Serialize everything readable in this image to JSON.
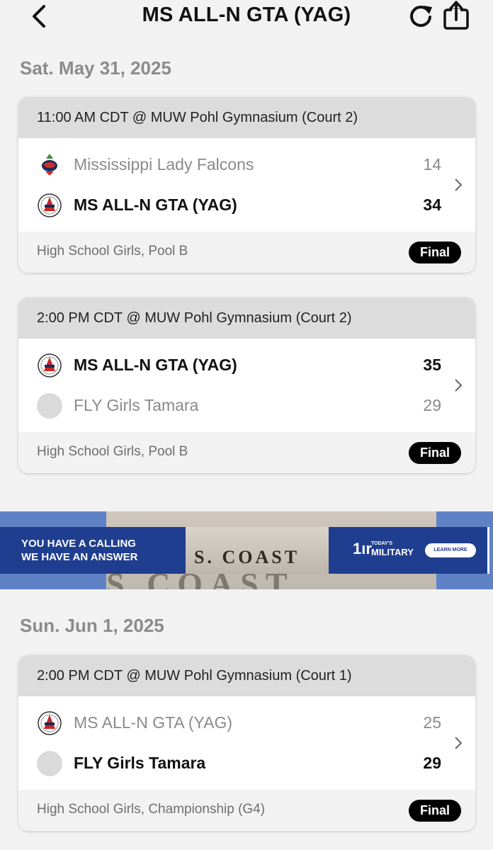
{
  "header": {
    "title": "MS ALL-N GTA (YAG)",
    "back_icon": "chevron-left-icon",
    "refresh_icon": "refresh-icon",
    "share_icon": "share-icon"
  },
  "days": [
    {
      "date": "Sat. May 31, 2025",
      "games": [
        {
          "header": "11:00 AM CDT @ MUW Pohl Gymnasium  (Court 2)",
          "teams": [
            {
              "name": "Mississippi Lady Falcons",
              "score": "14",
              "winner": false
            },
            {
              "name": "MS ALL-N GTA (YAG)",
              "score": "34",
              "winner": true
            }
          ],
          "division": "High School Girls, Pool B",
          "status": "Final"
        },
        {
          "header": "2:00 PM CDT @ MUW Pohl Gymnasium  (Court 2)",
          "teams": [
            {
              "name": "MS ALL-N GTA (YAG)",
              "score": "35",
              "winner": true
            },
            {
              "name": "FLY Girls Tamara",
              "score": "29",
              "winner": false
            }
          ],
          "division": "High School Girls, Pool B",
          "status": "Final"
        }
      ]
    },
    {
      "date": "Sun. Jun 1, 2025",
      "games": [
        {
          "header": "2:00 PM CDT @ MUW Pohl Gymnasium  (Court 1)",
          "teams": [
            {
              "name": "MS ALL-N GTA (YAG)",
              "score": "25",
              "winner": false
            },
            {
              "name": "FLY Girls Tamara",
              "score": "29",
              "winner": true
            }
          ],
          "division": "High School Girls, Championship (G4)",
          "status": "Final"
        }
      ]
    }
  ],
  "ad": {
    "line1": "YOU HAVE A CALLING",
    "line2": "WE HAVE AN ANSWER",
    "image_text": "S. COAST",
    "background_text": "S COAST",
    "logo_small": "TODAY'S",
    "logo_text": "MILITARY",
    "button": "LEARN MORE"
  },
  "colors": {
    "background": "#f2f2f2",
    "card_header": "#dcdcdc",
    "badge": "#000000",
    "date_text": "#8b8b8b",
    "ad_band": "#1f3e8f"
  }
}
